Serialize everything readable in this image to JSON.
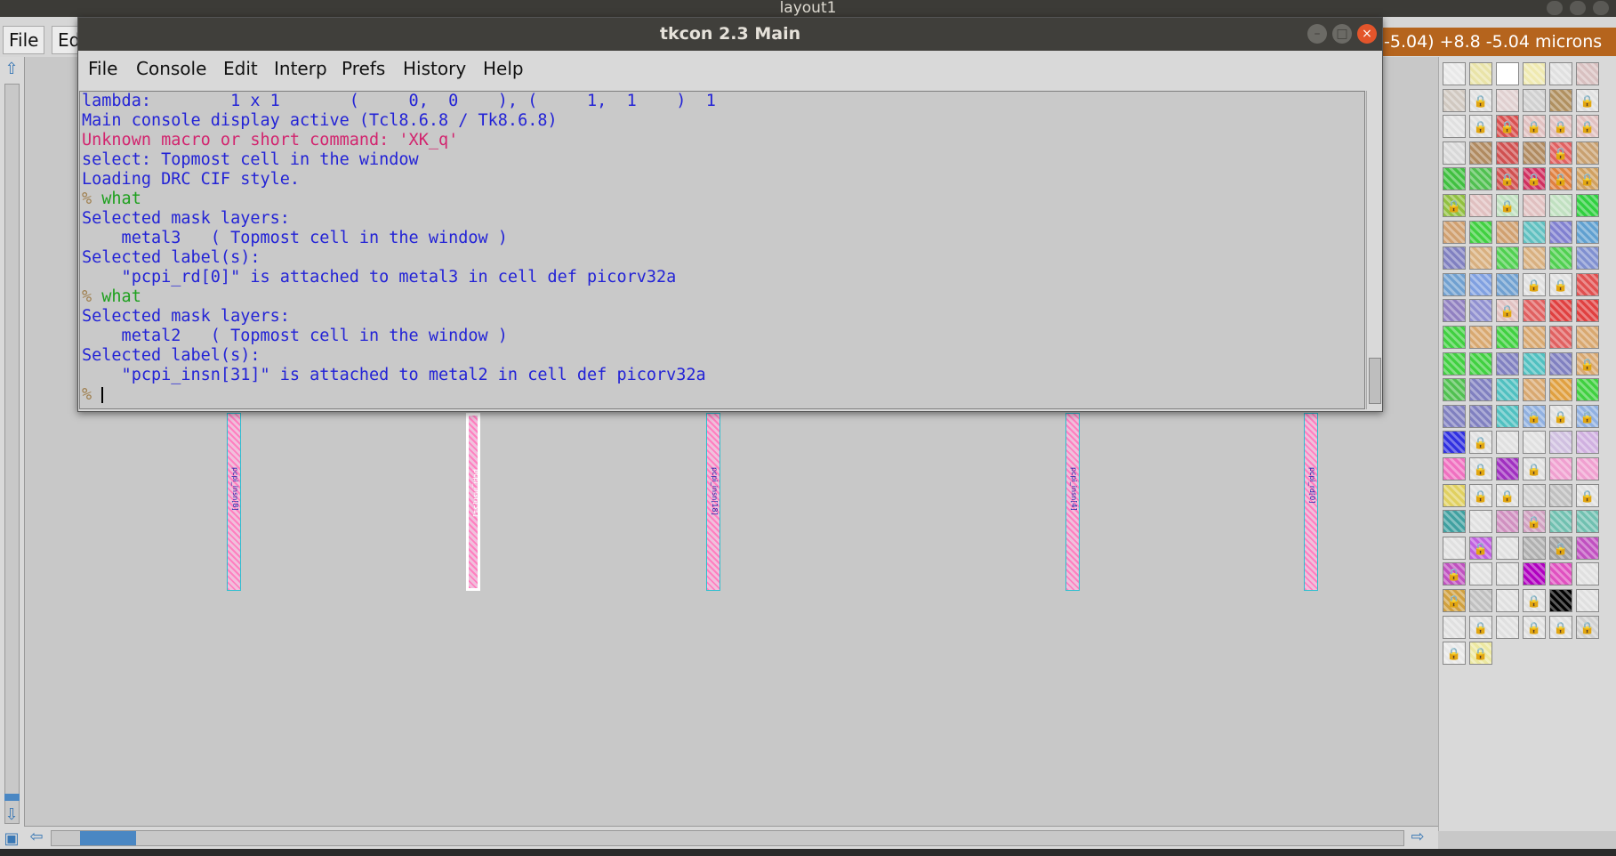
{
  "layout_window": {
    "title": "layout1",
    "menu": {
      "file": "File",
      "edit_partial": "Ed"
    },
    "coord_readout": "-5.04) +8.8 -5.04 microns",
    "pins": [
      {
        "label": "pcpi_insn[8]",
        "selected": false
      },
      {
        "label": "pcpi_insn[31]",
        "selected": true
      },
      {
        "label": "pcpi_insn[18]",
        "selected": false
      },
      {
        "label": "pcpi_insn[4]",
        "selected": false
      },
      {
        "label": "pcpi_rd[0]",
        "selected": false
      }
    ]
  },
  "tkcon": {
    "title": "tkcon 2.3 Main",
    "menu": [
      "File",
      "Console",
      "Edit",
      "Interp",
      "Prefs",
      "History",
      "Help"
    ],
    "lines": [
      {
        "text": "lambda:        1 x 1       (     0,  0    ), (     1,  1    )  1",
        "style": "blue"
      },
      {
        "text": "Main console display active (Tcl8.6.8 / Tk8.6.8)",
        "style": "blue"
      },
      {
        "text": "Unknown macro or short command: 'XK_q'",
        "style": "red"
      },
      {
        "text": "select: Topmost cell in the window",
        "style": "blue"
      },
      {
        "text": "Loading DRC CIF style.",
        "style": "blue"
      },
      {
        "text": "what",
        "style": "command"
      },
      {
        "text": "Selected mask layers:",
        "style": "blue"
      },
      {
        "text": "    metal3   ( Topmost cell in the window )",
        "style": "blue"
      },
      {
        "text": "Selected label(s):",
        "style": "blue"
      },
      {
        "text": "    \"pcpi_rd[0]\" is attached to metal3 in cell def picorv32a",
        "style": "blue"
      },
      {
        "text": "what",
        "style": "command"
      },
      {
        "text": "Selected mask layers:",
        "style": "blue"
      },
      {
        "text": "    metal2   ( Topmost cell in the window )",
        "style": "blue"
      },
      {
        "text": "Selected label(s):",
        "style": "blue"
      },
      {
        "text": "    \"pcpi_insn[31]\" is attached to metal2 in cell def picorv32a",
        "style": "blue"
      }
    ],
    "prompt": "%"
  },
  "colors": {
    "console_blue": "#2323d6",
    "console_red": "#d2246e",
    "console_green": "#1ea01e",
    "coord_bg": "#b5641d",
    "accent_blue": "#4a87c3"
  }
}
